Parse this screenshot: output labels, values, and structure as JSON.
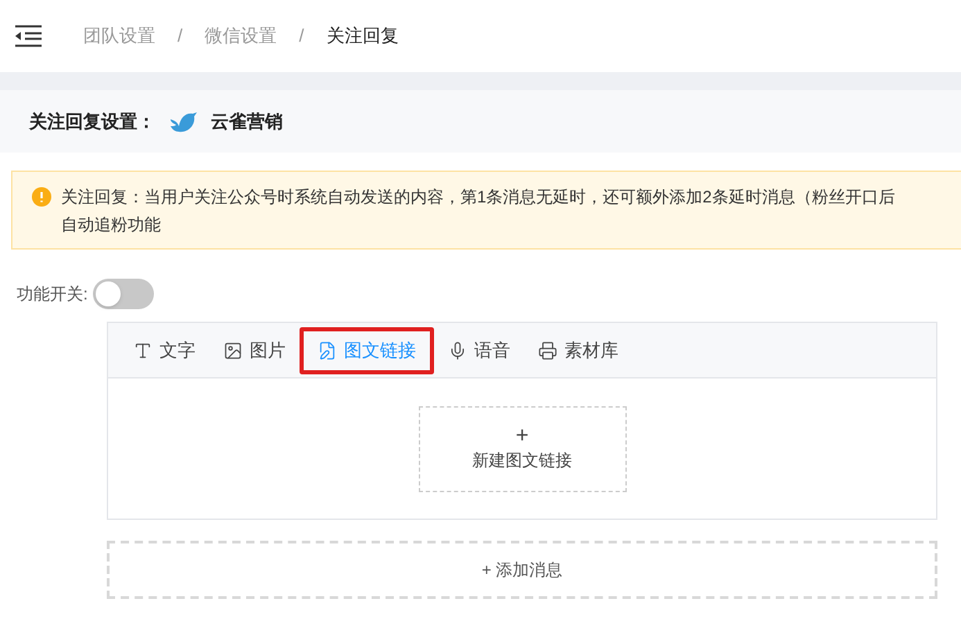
{
  "breadcrumb": [
    {
      "label": "团队设置",
      "current": false
    },
    {
      "label": "微信设置",
      "current": false
    },
    {
      "label": "关注回复",
      "current": true
    }
  ],
  "separator": "/",
  "settings": {
    "label": "关注回复设置：",
    "account": "云雀营销"
  },
  "alert": {
    "lines": [
      "关注回复：当用户关注公众号时系统自动发送的内容，第1条消息无延时，还可额外添加2条延时消息（粉丝开口后",
      "自动追粉功能"
    ]
  },
  "toggle": {
    "label": "功能开关:",
    "on": false
  },
  "tabs": [
    {
      "kind": "text",
      "label": "文字",
      "selected": false
    },
    {
      "kind": "image",
      "label": "图片",
      "selected": false
    },
    {
      "kind": "article",
      "label": "图文链接",
      "selected": true
    },
    {
      "kind": "voice",
      "label": "语音",
      "selected": false
    },
    {
      "kind": "library",
      "label": "素材库",
      "selected": false
    }
  ],
  "new_card": {
    "plus": "+",
    "label": "新建图文链接"
  },
  "add_button": "+ 添加消息"
}
